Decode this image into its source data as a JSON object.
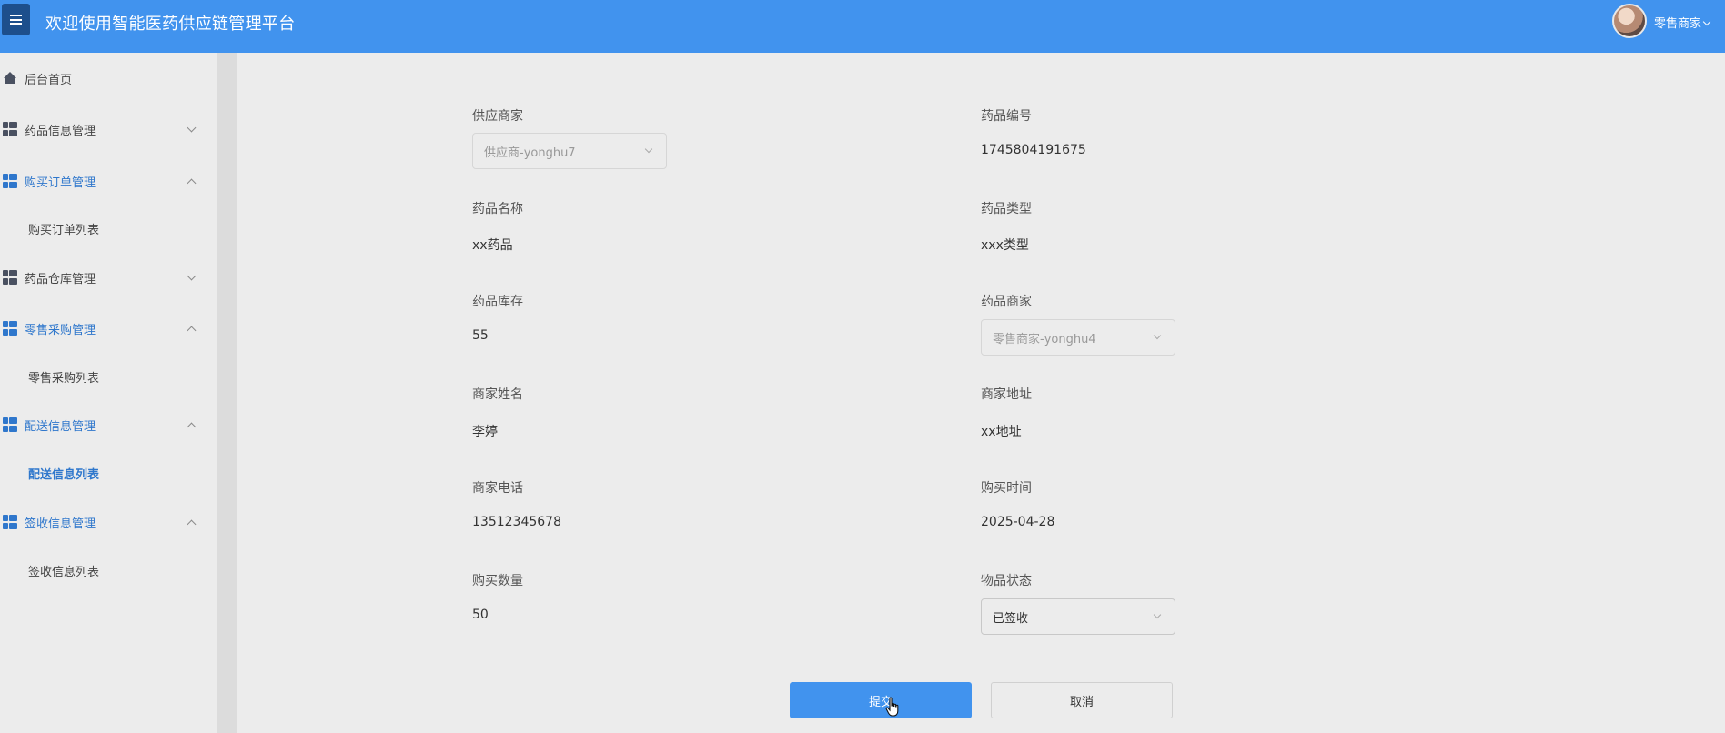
{
  "header": {
    "title": "欢迎使用智能医药供应链管理平台",
    "user_name": "零售商家"
  },
  "sidebar": {
    "home": "后台首页",
    "groups": [
      {
        "label": "药品信息管理",
        "expanded": false
      },
      {
        "label": "购买订单管理",
        "expanded": true,
        "children": [
          "购买订单列表"
        ]
      },
      {
        "label": "药品仓库管理",
        "expanded": false
      },
      {
        "label": "零售采购管理",
        "expanded": true,
        "children": [
          "零售采购列表"
        ]
      },
      {
        "label": "配送信息管理",
        "expanded": true,
        "children": [
          "配送信息列表"
        ]
      },
      {
        "label": "签收信息管理",
        "expanded": true,
        "children": [
          "签收信息列表"
        ]
      }
    ]
  },
  "form": {
    "supplier": {
      "label": "供应商家",
      "value": "供应商-yonghu7"
    },
    "drug_code": {
      "label": "药品编号",
      "value": "1745804191675"
    },
    "drug_name": {
      "label": "药品名称",
      "value": "xx药品"
    },
    "drug_type": {
      "label": "药品类型",
      "value": "xxx类型"
    },
    "stock": {
      "label": "药品库存",
      "value": "55"
    },
    "merchant": {
      "label": "药品商家",
      "value": "零售商家-yonghu4"
    },
    "merchant_name": {
      "label": "商家姓名",
      "value": "李婷"
    },
    "merchant_address": {
      "label": "商家地址",
      "value": "xx地址"
    },
    "merchant_phone": {
      "label": "商家电话",
      "value": "13512345678"
    },
    "purchase_time": {
      "label": "购买时间",
      "value": "2025-04-28"
    },
    "quantity": {
      "label": "购买数量",
      "value": "50"
    },
    "status": {
      "label": "物品状态",
      "value": "已签收"
    }
  },
  "actions": {
    "submit": "提交",
    "cancel": "取消"
  },
  "colors": {
    "header": "#4193ee",
    "accent": "#2f77cc",
    "background": "#ececec"
  }
}
